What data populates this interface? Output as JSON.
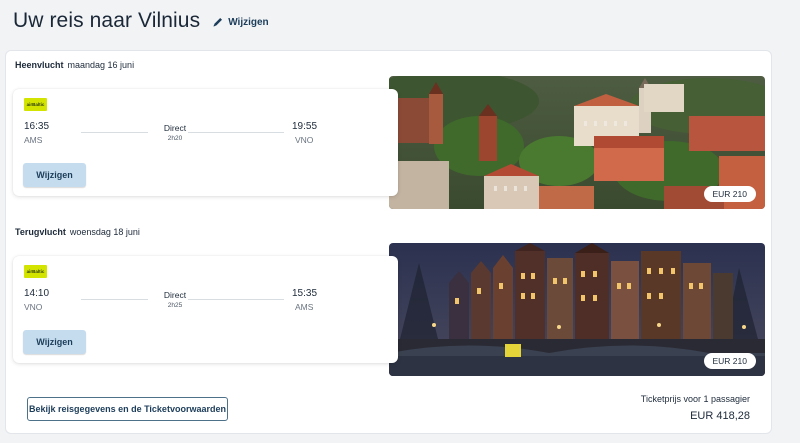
{
  "header": {
    "title": "Uw reis naar Vilnius",
    "edit_label": "Wijzigen"
  },
  "outbound": {
    "label": "Heenvlucht",
    "date": "maandag 16 juni",
    "airline_logo_text": "airBaltic",
    "departure_time": "16:35",
    "departure_code": "AMS",
    "stops": "Direct",
    "duration": "2h20",
    "arrival_time": "19:55",
    "arrival_code": "VNO",
    "change_label": "Wijzigen",
    "price": "EUR 210"
  },
  "return": {
    "label": "Terugvlucht",
    "date": "woensdag 18 juni",
    "airline_logo_text": "airBaltic",
    "departure_time": "14:10",
    "departure_code": "VNO",
    "stops": "Direct",
    "duration": "2h25",
    "arrival_time": "15:35",
    "arrival_code": "AMS",
    "change_label": "Wijzigen",
    "price": "EUR 210"
  },
  "footer": {
    "details_label": "Bekijk reisgegevens en de Ticketvoorwaarden",
    "price_note": "Ticketprijs voor 1 passagier",
    "total": "EUR 418,28"
  },
  "colors": {
    "accent": "#1c3d5a",
    "button_bg": "#c5dcee",
    "airline_brand": "#d2e400"
  },
  "icons": {
    "edit": "pencil-icon"
  }
}
